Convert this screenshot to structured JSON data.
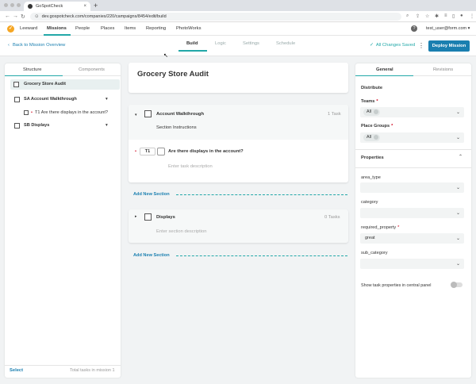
{
  "browser": {
    "tab_title": "GoSpotCheck",
    "url": "dev.gospotcheck.com/companies/220/campaigns/8454/edit/build"
  },
  "app_nav": {
    "items": [
      "Leeward",
      "Missions",
      "People",
      "Places",
      "Items",
      "Reporting",
      "PhotoWorks"
    ],
    "active": "Missions",
    "help": "?",
    "user": "test_user@form.com ▾"
  },
  "subheader": {
    "back_label": "Back to Mission Overview",
    "tabs": [
      "Build",
      "Logic",
      "Settings",
      "Schedule"
    ],
    "active_tab": "Build",
    "saved_label": "All Changes Saved",
    "deploy_label": "Deploy Mission"
  },
  "left_panel": {
    "tabs": [
      "Structure",
      "Components"
    ],
    "mission": "Grocery Store Audit",
    "tree": [
      {
        "label": "SA  Account Walkthrough"
      },
      {
        "label": "T1  Are there displays in the account?"
      },
      {
        "label": "SB  Displays"
      }
    ],
    "select_label": "Select",
    "total_label": "Total tasks in mission 1"
  },
  "center": {
    "mission_title": "Grocery Store Audit",
    "section1": {
      "title": "Account Walkthrough",
      "count": "1 Task",
      "instructions": "Section Instructions",
      "task_id": "T1",
      "task_q": "Are there displays in the account?",
      "task_desc": "Enter task description"
    },
    "add_section": "Add New Section",
    "section2": {
      "title": "Displays",
      "count": "0 Tasks",
      "desc": "Enter section description"
    }
  },
  "right_panel": {
    "tabs": [
      "General",
      "Revisions"
    ],
    "distribute": "Distribute",
    "teams_label": "Teams",
    "teams_value": "All",
    "place_groups_label": "Place Groups",
    "place_groups_value": "All",
    "properties": "Properties",
    "fields": [
      {
        "label": "area_type",
        "required": false,
        "value": ""
      },
      {
        "label": "category",
        "required": false,
        "value": ""
      },
      {
        "label": "required_property",
        "required": true,
        "value": "great"
      },
      {
        "label": "sub_category",
        "required": false,
        "value": ""
      }
    ],
    "show_props_label": "Show task properties in central panel"
  },
  "colors": {
    "accent": "#22a8a8",
    "primary": "#1a7fb0",
    "brand": "#f5a623"
  }
}
